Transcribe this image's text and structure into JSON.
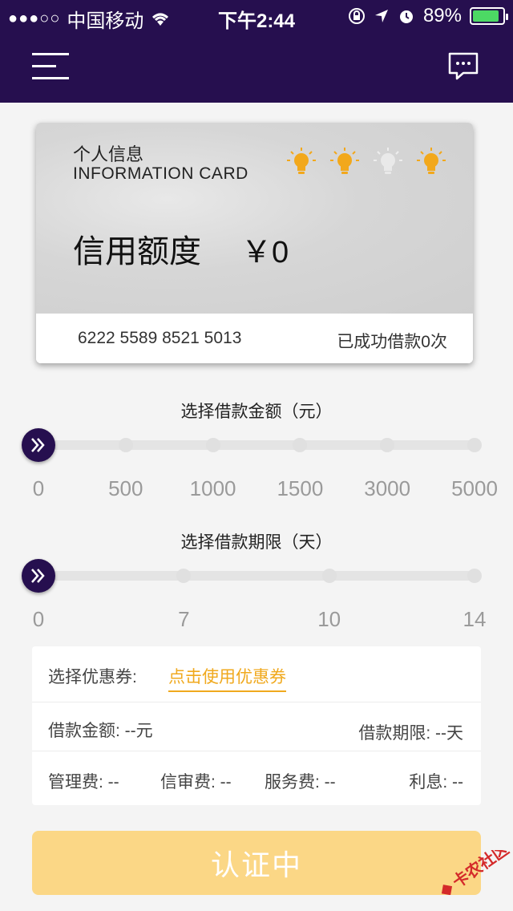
{
  "status_bar": {
    "signal_dots": "●●●○○",
    "carrier": "中国移动",
    "time": "下午2:44",
    "battery": "89%",
    "battery_level": 0.89
  },
  "card": {
    "title": "个人信息",
    "subtitle": "INFORMATION CARD",
    "bulbs": [
      {
        "icon": "lightbulb-icon",
        "lit": true
      },
      {
        "icon": "lightbulb-icon",
        "lit": true
      },
      {
        "icon": "lightbulb-icon",
        "lit": false
      },
      {
        "icon": "lightbulb-icon",
        "lit": true
      }
    ],
    "credit_label": "信用额度",
    "credit_value": "￥0",
    "card_number": "6222 5589 8521 5013",
    "loan_count": "已成功借款0次"
  },
  "amount_slider": {
    "title": "选择借款金额（元）",
    "ticks": [
      "0",
      "500",
      "1000",
      "1500",
      "3000",
      "5000"
    ],
    "selected": "0"
  },
  "term_slider": {
    "title": "选择借款期限（天）",
    "ticks": [
      "0",
      "7",
      "10",
      "14"
    ],
    "selected": "0"
  },
  "info_panel": {
    "coupon_label": "选择优惠券:",
    "coupon_link": "点击使用优惠券",
    "loan_amount": "借款金额: --元",
    "loan_term": "借款期限: --天",
    "management_fee": "管理费: --",
    "review_fee": "信审费: --",
    "service_fee": "服务费: --",
    "interest": "利息: --"
  },
  "submit_button": "认证中",
  "watermark": "卡农社区",
  "colors": {
    "header": "#260f4f",
    "accent": "#f0a91e",
    "button": "#fbd786"
  }
}
